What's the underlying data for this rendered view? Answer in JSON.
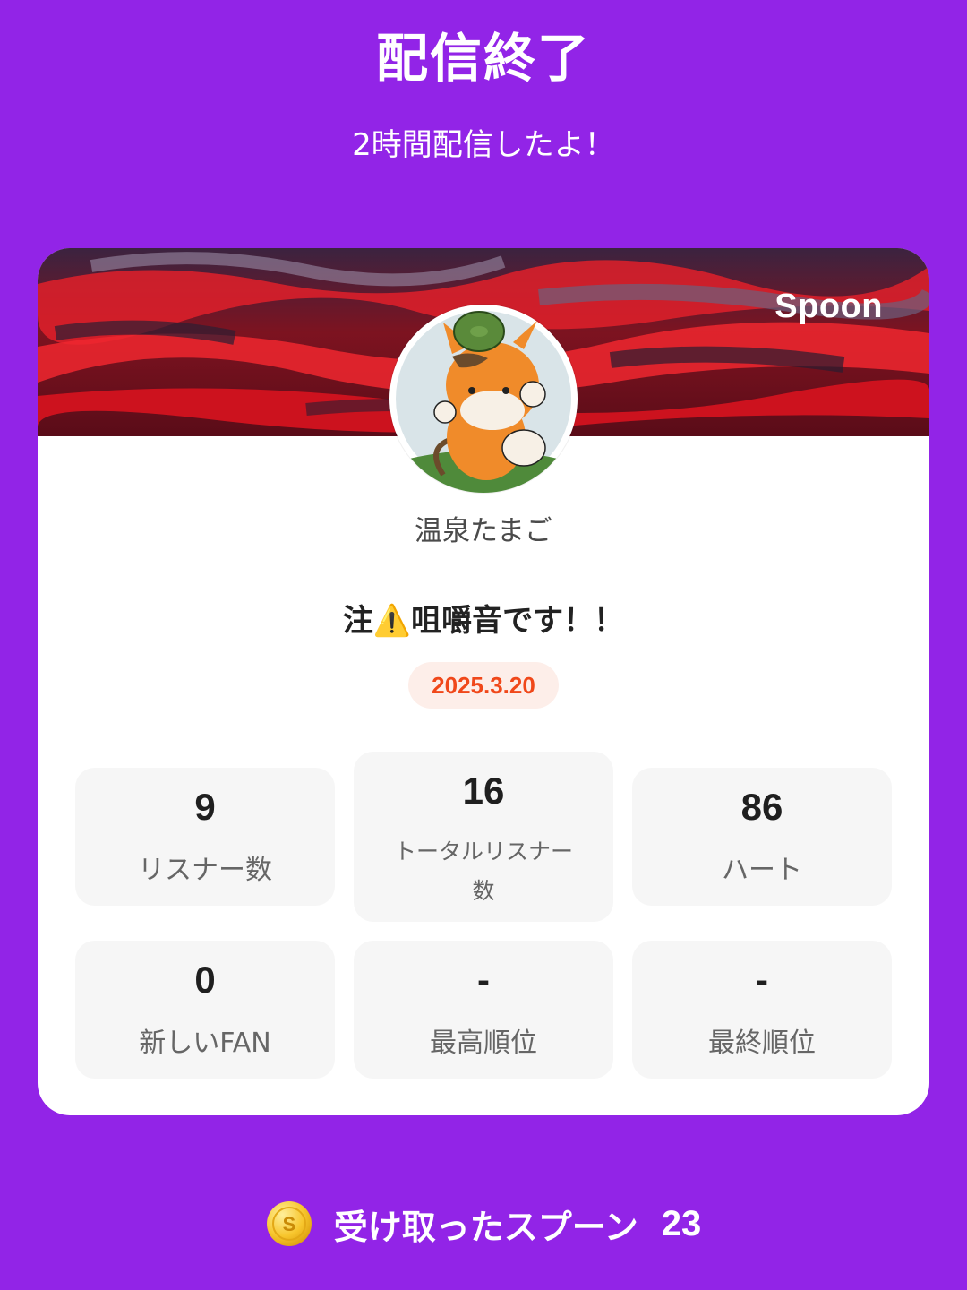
{
  "header": {
    "title": "配信終了",
    "subtitle": "2時間配信したよ！"
  },
  "card": {
    "brand": "Spoon",
    "username": "温泉たまご",
    "live_title": "注⚠️咀嚼音です！！",
    "date": "2025.3.20",
    "stats": [
      {
        "value": "9",
        "label": "リスナー数"
      },
      {
        "value": "16",
        "label": "トータルリスナー数"
      },
      {
        "value": "86",
        "label": "ハート"
      },
      {
        "value": "0",
        "label": "新しいFAN"
      },
      {
        "value": "-",
        "label": "最高順位"
      },
      {
        "value": "-",
        "label": "最終順位"
      }
    ]
  },
  "footer": {
    "label": "受け取ったスプーン",
    "value": "23"
  },
  "colors": {
    "background": "#9224e7",
    "date_text": "#f0481a",
    "date_bg": "#fdeee9",
    "stat_bg": "#f6f6f6"
  },
  "icons": {
    "coin": "spoon-coin-icon"
  }
}
